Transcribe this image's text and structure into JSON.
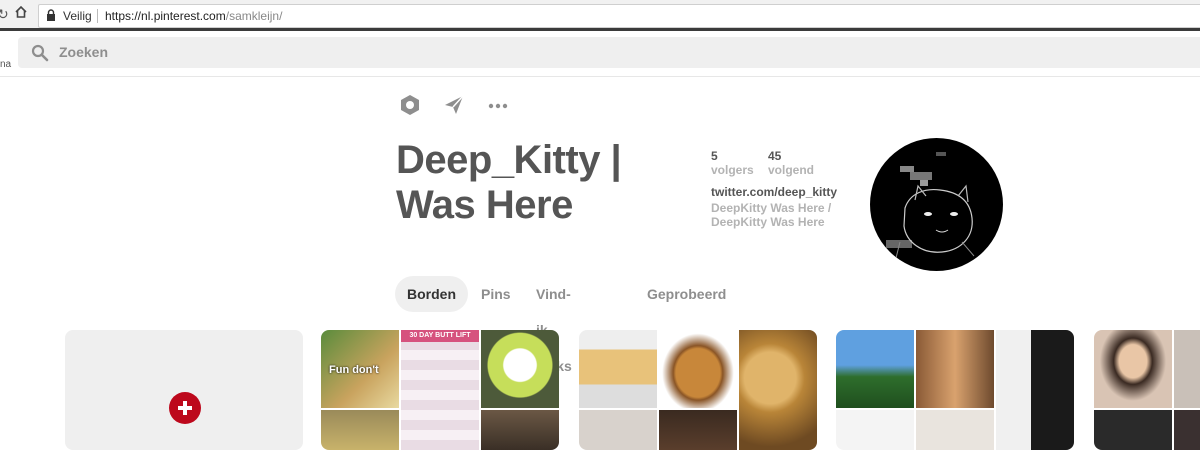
{
  "browser": {
    "security_label": "Veilig",
    "url_host": "https://nl.pinterest.com",
    "url_path": "/samkleijn/"
  },
  "header": {
    "cut_text": "na",
    "search_placeholder": "Zoeken"
  },
  "profile": {
    "name": "Deep_Kitty | Was Here",
    "followers_count": "5",
    "followers_label": "volgers",
    "following_count": "45",
    "following_label": "volgend",
    "website": "twitter.com/deep_kitty",
    "description": "DeepKitty Was Here / DeepKitty Was Here"
  },
  "tabs": [
    {
      "label": "Borden",
      "active": true
    },
    {
      "label": "Pins",
      "active": false
    },
    {
      "label": "Vind-ik-leuks",
      "active": false
    },
    {
      "label": "Geprobeerd",
      "active": false
    }
  ],
  "boards": {
    "board1_image_text": "Fun don't",
    "board1_poster_text": "30 DAY BUTT LIFT"
  },
  "colors": {
    "accent_red": "#bd081c",
    "tab_bg": "#efefef"
  }
}
